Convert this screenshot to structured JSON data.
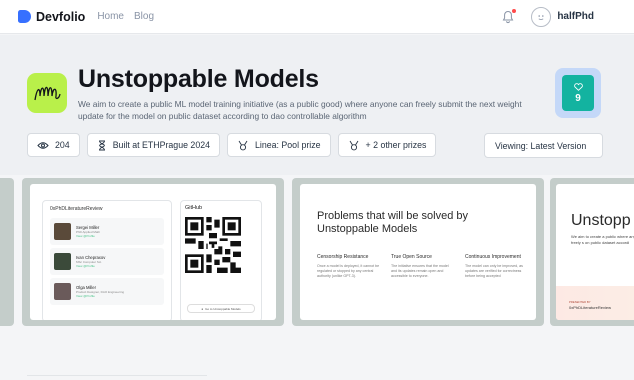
{
  "nav": {
    "brand": "Devfolio",
    "links": [
      "Home",
      "Blog"
    ],
    "username": "halfPhd"
  },
  "project": {
    "title": "Unstoppable Models",
    "description": "We aim to create a public ML model training initiative (as a public good) where anyone can freely submit the next weight update for the model on public dataset according to dao controllable algorithm",
    "likes": "9",
    "views": "204",
    "built_at": "Built at ETHPrague 2024",
    "prize": "Linea: Pool prize",
    "other_prizes": "+ 2 other prizes",
    "version": "Viewing: Latest Version"
  },
  "gallery": {
    "slide1": {
      "heading": "0xPhDLiteratureReview",
      "people": [
        {
          "name": "Sergei Miller",
          "sub": "PhD Applied Math",
          "tag": "View @Profile"
        },
        {
          "name": "Ivan Chepraxov",
          "sub": "MSc Computer Sci.",
          "tag": "View @Profile"
        },
        {
          "name": "Olga Miller",
          "sub": "Product Designer, DAO Engineering",
          "tag": "View @Profile"
        }
      ],
      "github": "GitHub",
      "github_btn": "Go to Unstoppable Models"
    },
    "slide2": {
      "title": "Problems that will be solved by Unstoppable Models",
      "columns": [
        {
          "head": "Censorship Resistance",
          "text": "Once a model is deployed, it cannot be regulated or stopped by any central authority (unlike GPT-3)."
        },
        {
          "head": "True Open Source",
          "text": "The initiative ensures that the model and its updates remain open and accessible to everyone."
        },
        {
          "head": "Continuous Improvement",
          "text": "The model can only be improved, as updates are verified for correctness before being accepted"
        }
      ]
    },
    "slide3": {
      "title": "Unstopp",
      "desc": "We aim to create a public where anyone can freely s on public dataset accordi",
      "label": "PRESENTED BY",
      "by": "0xPhDLiteratureReview"
    }
  },
  "colors": {
    "accent": "#3770ff",
    "like": "#13b3a0",
    "logo_bg": "#b9f04a"
  }
}
